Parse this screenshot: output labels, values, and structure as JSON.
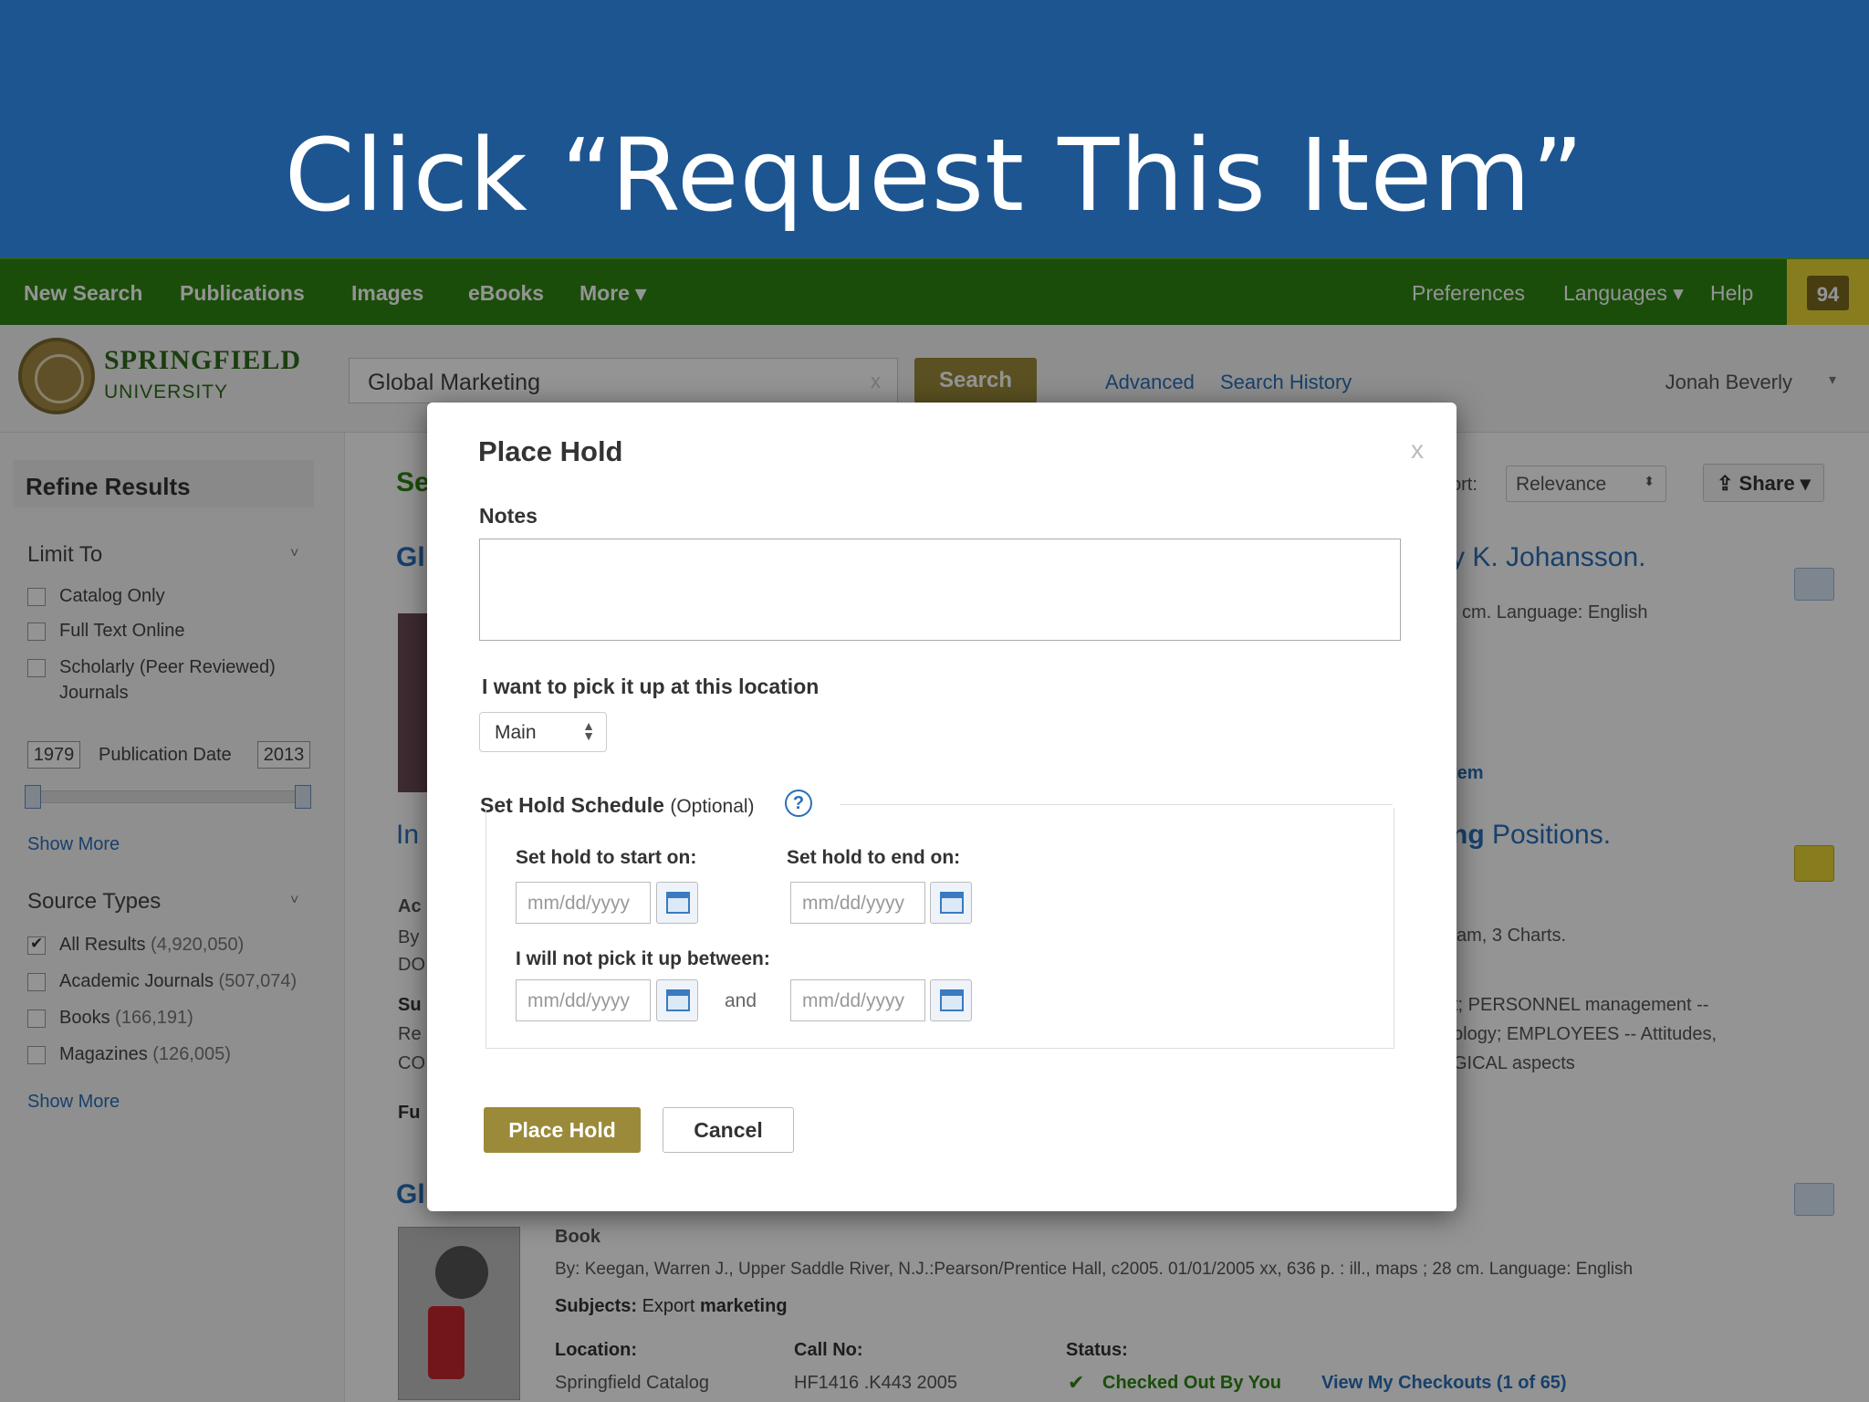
{
  "slide": {
    "title": "Click “Request This Item”"
  },
  "topnav": {
    "left": [
      "New Search",
      "Publications",
      "Images",
      "eBooks",
      "More ▾"
    ],
    "right": [
      "Preferences",
      "Languages ▾",
      "Help"
    ],
    "folder_count": "94"
  },
  "header": {
    "logo_name": "SPRINGFIELD",
    "logo_sub": "UNIVERSITY",
    "search_value": "Global Marketing",
    "search_clear": "x",
    "search_button": "Search",
    "advanced_link": "Advanced",
    "history_link": "Search History",
    "user_name": "Jonah Beverly",
    "user_caret": "▾"
  },
  "sidebar": {
    "refine_title": "Refine Results",
    "limit_heading": "Limit To",
    "limit_items": [
      "Catalog Only",
      "Full Text Online",
      "Scholarly (Peer Reviewed)",
      "Journals"
    ],
    "year_from": "1979",
    "date_label": "Publication Date",
    "year_to": "2013",
    "show_more_1": "Show More",
    "source_heading": "Source Types",
    "sources": [
      {
        "label": "All Results",
        "count": "(4,920,050)",
        "checked": true
      },
      {
        "label": "Academic Journals",
        "count": "(507,074)",
        "checked": false
      },
      {
        "label": "Books",
        "count": "(166,191)",
        "checked": false
      },
      {
        "label": "Magazines",
        "count": "(126,005)",
        "checked": false
      }
    ],
    "show_more_2": "Show More",
    "caret": "˅"
  },
  "content": {
    "results_heading_fragment": "Se",
    "sort_label": "ort:",
    "sort_value": "Relevance",
    "share_label": "Share ▾",
    "result1_title_left": "Gl",
    "result1_title_right": "y K. Johansson.",
    "result1_meta": "cm. Language: English",
    "result1_link": "tem",
    "result2_title_left": "In",
    "result2_title_right_bold": "ng",
    "result2_title_right": " Positions.",
    "result2_line1": "Ac",
    "result2_line2": "By",
    "result2_line3": "DO",
    "result2_meta": "am, 3 Charts.",
    "result2_sub_left1": "Su",
    "result2_sub_left2": "Re",
    "result2_sub_left3": "CO",
    "result2_sub1": "t; PERSONNEL management --",
    "result2_sub2": "ology; EMPLOYEES -- Attitudes,",
    "result2_sub3": "GICAL aspects",
    "result2_fu": "Fu",
    "result3_title_left": "Gl",
    "result3_type": "Book",
    "result3_by": "By: Keegan, Warren J., Upper Saddle River, N.J.:Pearson/Prentice Hall, c2005. 01/01/2005 xx, 636 p. : ill., maps ; 28 cm. Language: English",
    "result3_subjects_label": "Subjects:",
    "result3_subjects_value": " Export ",
    "result3_subjects_bold": "marketing",
    "location_label": "Location:",
    "location_value": "Springfield Catalog",
    "callno_label": "Call No:",
    "callno_value": "HF1416 .K443 2005",
    "status_label": "Status:",
    "status_value": "Checked Out By You",
    "checkouts_link": "View My Checkouts (1 of 65)"
  },
  "modal": {
    "title": "Place Hold",
    "close": "x",
    "notes_label": "Notes",
    "notes_value": "",
    "location_label": "I want to pick it up at this location",
    "location_value": "Main",
    "schedule_label": "Set Hold Schedule",
    "schedule_optional": "(Optional)",
    "help": "?",
    "start_label": "Set hold to start on:",
    "end_label": "Set hold to end on:",
    "not_between_label": "I will not pick it up between:",
    "date_placeholder": "mm/dd/yyyy",
    "and": "and",
    "place_hold_button": "Place Hold",
    "cancel_button": "Cancel"
  },
  "colors": {
    "banner": "#1d5590",
    "nav_green": "#2d8512",
    "gold_button": "#9b8a3a",
    "link_blue": "#2a6fb8"
  }
}
